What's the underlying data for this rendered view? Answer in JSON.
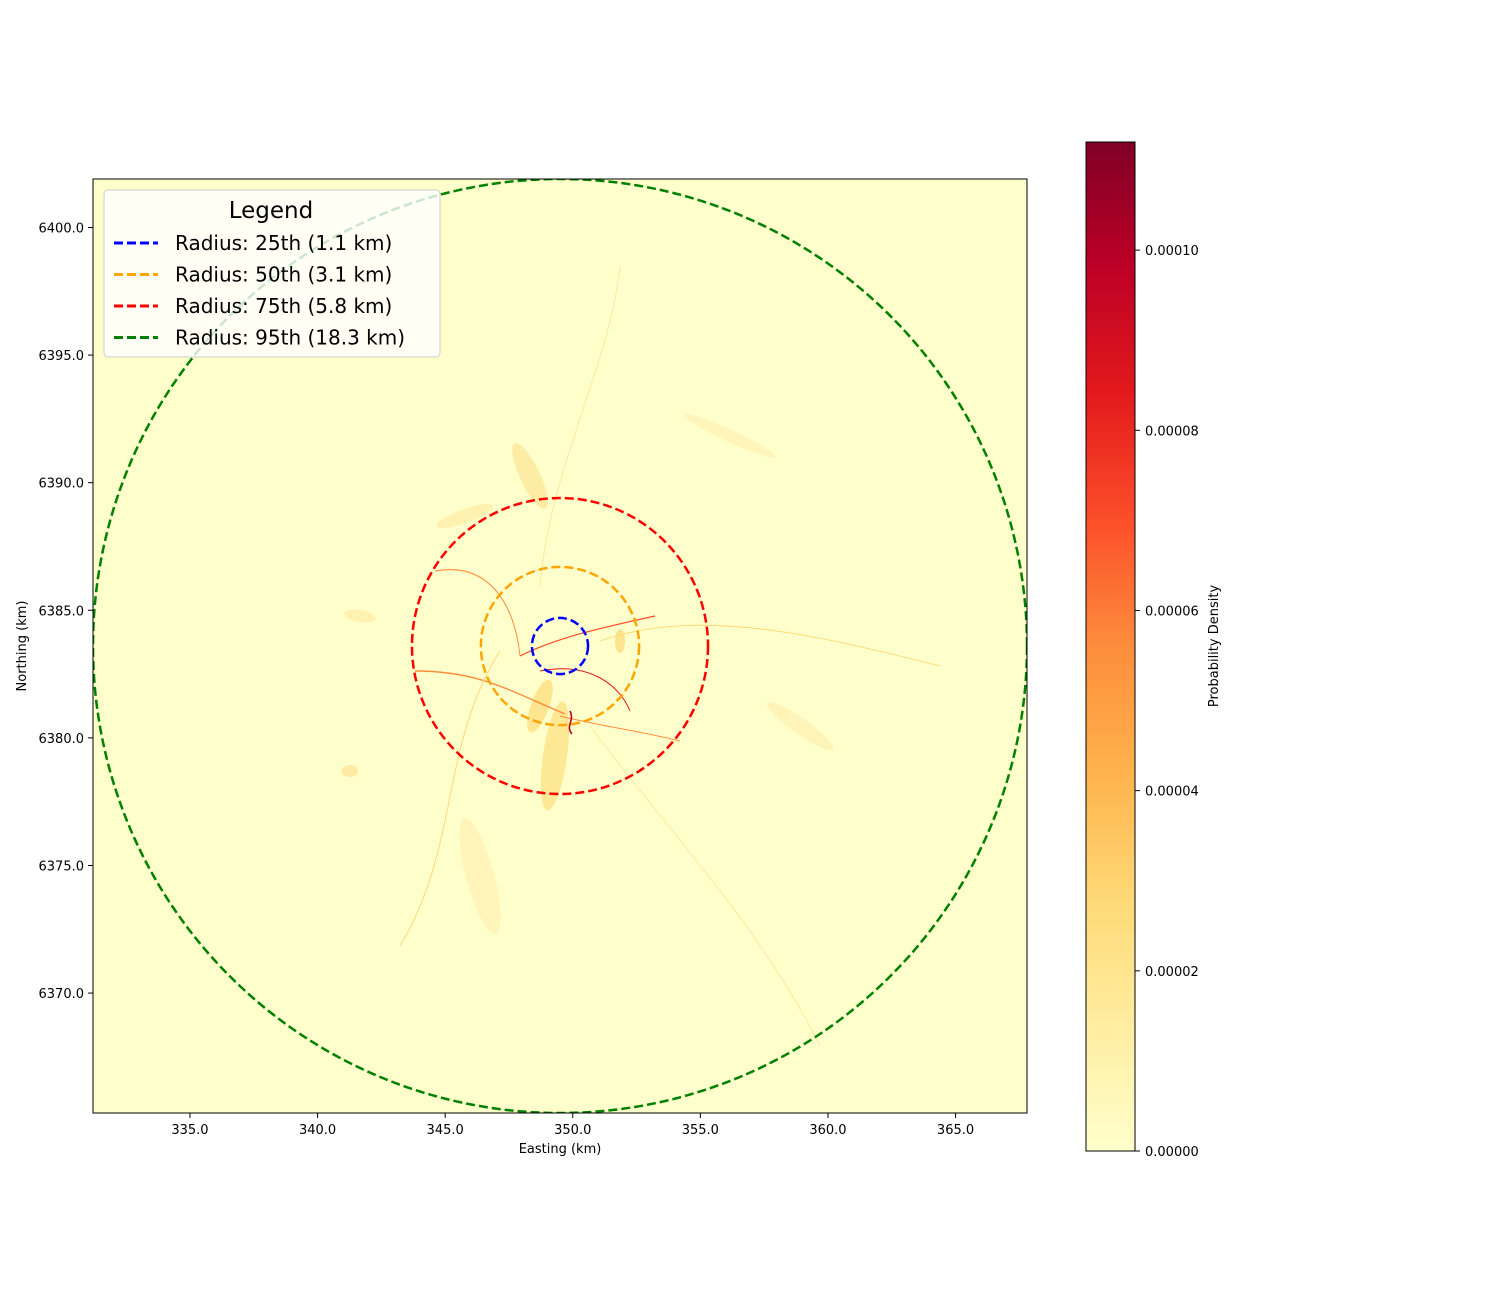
{
  "chart_data": {
    "type": "heatmap",
    "xlabel": "Easting (km)",
    "ylabel": "Northing (km)",
    "xlim": [
      331.2,
      367.8
    ],
    "ylim": [
      6365.3,
      6401.9
    ],
    "x_ticks": [
      335.0,
      340.0,
      345.0,
      350.0,
      355.0,
      360.0,
      365.0
    ],
    "y_ticks": [
      6370.0,
      6375.0,
      6380.0,
      6385.0,
      6390.0,
      6395.0,
      6400.0
    ],
    "center": {
      "x": 349.5,
      "y": 6383.6
    },
    "series": [
      {
        "name": "Radius: 25th (1.1 km)",
        "radius_km": 1.1,
        "color": "#0000ff",
        "style": "dashed"
      },
      {
        "name": "Radius: 50th (3.1 km)",
        "radius_km": 3.1,
        "color": "#ffa500",
        "style": "dashed"
      },
      {
        "name": "Radius: 75th (5.8 km)",
        "radius_km": 5.8,
        "color": "#ff0000",
        "style": "dashed"
      },
      {
        "name": "Radius: 95th (18.3 km)",
        "radius_km": 18.3,
        "color": "#008000",
        "style": "dashed"
      }
    ],
    "legend": {
      "title": "Legend",
      "placement": "upper-left"
    },
    "colorbar": {
      "label": "Probability Density",
      "colormap": "YlOrRd",
      "range": [
        0,
        0.000112
      ],
      "ticks": [
        0.0,
        2e-05,
        4e-05,
        6e-05,
        8e-05,
        0.0001
      ],
      "tick_labels": [
        "0.00000",
        "0.00002",
        "0.00004",
        "0.00006",
        "0.00008",
        "0.00010"
      ],
      "colors": [
        "#ffffcc",
        "#ffeda0",
        "#fed976",
        "#feb24c",
        "#fd8d3c",
        "#fc4e2a",
        "#e31a1c",
        "#bd0026",
        "#800026"
      ]
    },
    "background_color": "#ffffcc",
    "grid": false
  }
}
